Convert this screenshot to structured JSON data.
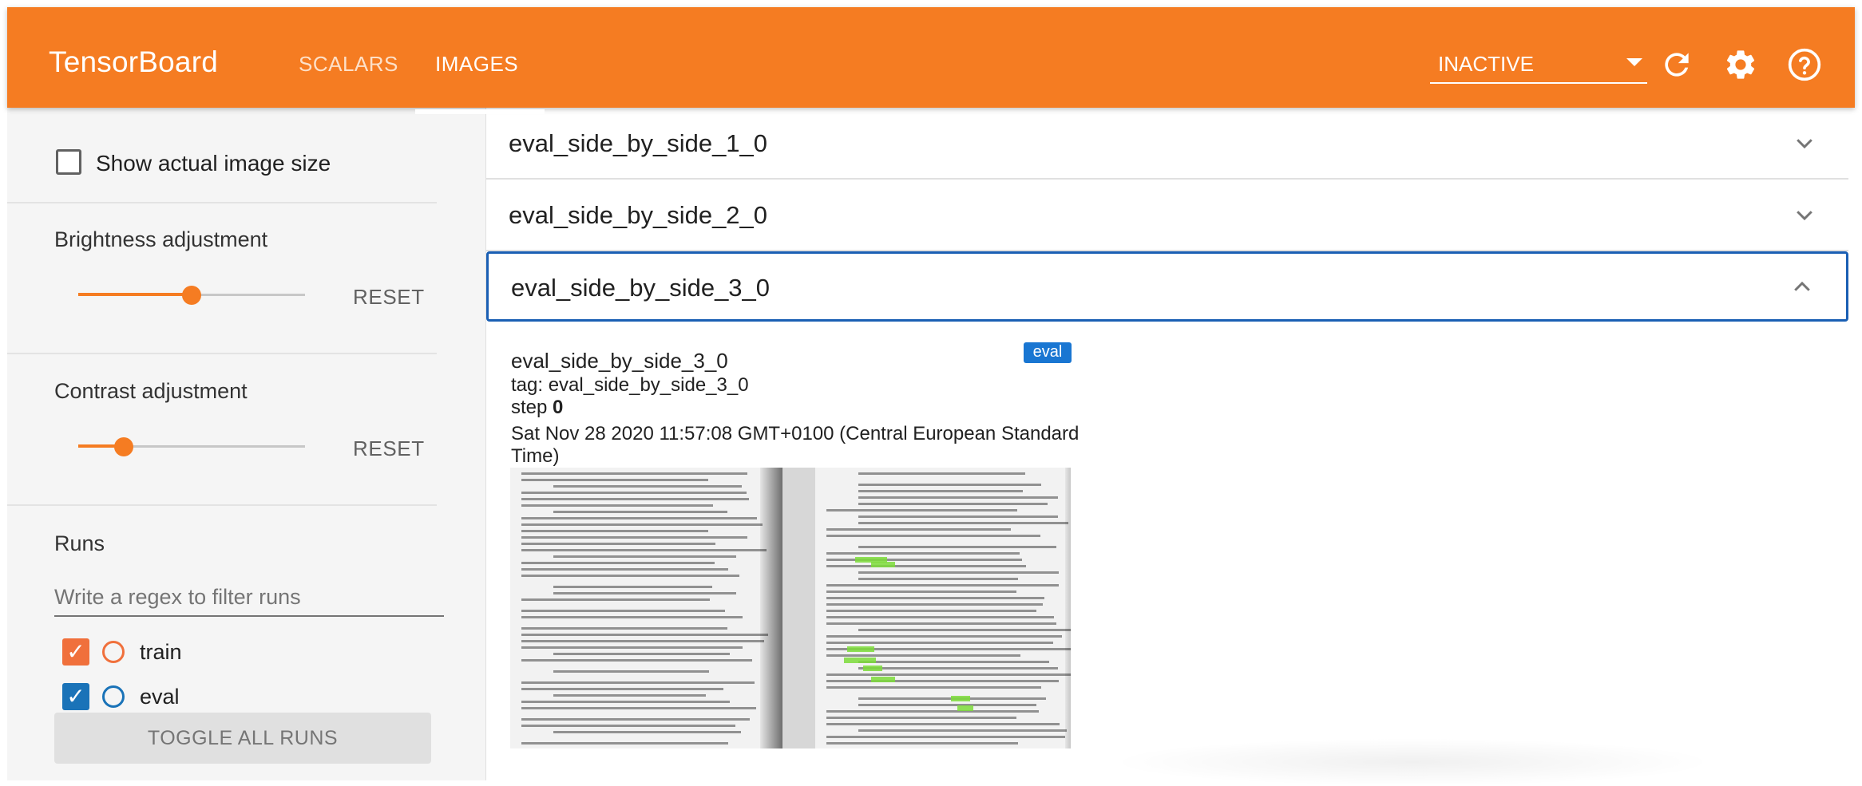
{
  "app": {
    "brand": "TensorBoard",
    "tabs": [
      {
        "label": "SCALARS",
        "active": false
      },
      {
        "label": "IMAGES",
        "active": true
      }
    ],
    "run_status": "INACTIVE",
    "icons": [
      "refresh-icon",
      "settings-icon",
      "help-icon"
    ],
    "accent_color": "#f57c22"
  },
  "sidebar": {
    "show_actual_size_label": "Show actual image size",
    "show_actual_size_checked": false,
    "brightness": {
      "label": "Brightness adjustment",
      "reset_label": "RESET",
      "value": 0.5
    },
    "contrast": {
      "label": "Contrast adjustment",
      "reset_label": "RESET",
      "value": 0.2
    },
    "runs": {
      "title": "Runs",
      "filter_placeholder": "Write a regex to filter runs",
      "items": [
        {
          "name": "train",
          "checked": true,
          "color": "#f0703c"
        },
        {
          "name": "eval",
          "checked": true,
          "color": "#1a73b8"
        }
      ],
      "toggle_all_label": "TOGGLE ALL RUNS"
    }
  },
  "main": {
    "cards": [
      {
        "title": "eval_side_by_side_1_0",
        "expanded": false
      },
      {
        "title": "eval_side_by_side_2_0",
        "expanded": false
      },
      {
        "title": "eval_side_by_side_3_0",
        "expanded": true
      }
    ],
    "image_pane": {
      "title": "eval_side_by_side_3_0",
      "run_badge": "eval",
      "tag_line": "tag: eval_side_by_side_3_0",
      "step_prefix": "step",
      "step_value": "0",
      "timestamp_line1": "Sat Nov 28 2020 11:57:08 GMT+0100 (Central European Standard",
      "timestamp_line2": "Time)"
    }
  }
}
